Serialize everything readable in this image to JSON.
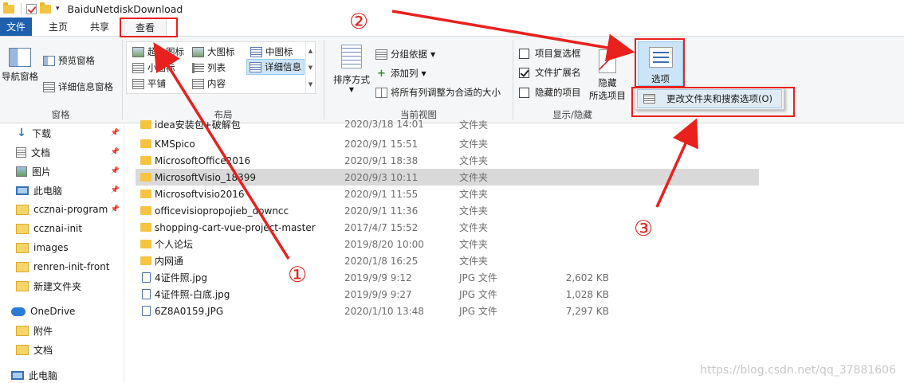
{
  "window": {
    "title": "BaiduNetdiskDownload"
  },
  "tabs": [
    "文件",
    "主页",
    "共享",
    "查看"
  ],
  "ribbon": {
    "pane_group": {
      "label": "窗格",
      "nav_pane": "导航窗格",
      "preview": "预览窗格",
      "details": "详细信息窗格"
    },
    "layout_group": {
      "label": "布局",
      "items": [
        "超大图标",
        "大图标",
        "中图标",
        "小图标",
        "列表",
        "详细信息",
        "平铺",
        "内容"
      ]
    },
    "current_view_group": {
      "label": "当前视图",
      "sort": "排序方式",
      "group_by": "分组依据",
      "add_column": "添加列",
      "fit_columns": "将所有列调整为合适的大小"
    },
    "show_hide_group": {
      "label": "显示/隐藏",
      "item_checkbox": "项目复选框",
      "extensions": "文件扩展名",
      "hidden_items": "隐藏的项目",
      "hide_selected_1": "隐藏",
      "hide_selected_2": "所选项目"
    },
    "options": {
      "label": "选项",
      "dropdown_item": "更改文件夹和搜索选项(O)"
    }
  },
  "checkboxes": {
    "item_checkbox": false,
    "extensions": true,
    "hidden_items": false
  },
  "nav": [
    {
      "label": "下载",
      "icon": "download-icon",
      "pinned": true
    },
    {
      "label": "文档",
      "icon": "document-icon",
      "pinned": true
    },
    {
      "label": "图片",
      "icon": "picture-icon",
      "pinned": true
    },
    {
      "label": "此电脑",
      "icon": "computer-icon",
      "pinned": true
    },
    {
      "label": "ccznai-program",
      "icon": "folder-icon",
      "pinned": true
    },
    {
      "label": "ccznai-init",
      "icon": "folder-icon",
      "pinned": false
    },
    {
      "label": "images",
      "icon": "folder-icon",
      "pinned": false
    },
    {
      "label": "renren-init-front",
      "icon": "folder-icon",
      "pinned": false
    },
    {
      "label": "新建文件夹",
      "icon": "folder-icon",
      "pinned": false
    },
    {
      "label": "OneDrive",
      "icon": "onedrive-icon",
      "pinned": false
    },
    {
      "label": "附件",
      "icon": "folder-icon",
      "pinned": false
    },
    {
      "label": "文档",
      "icon": "folder-icon",
      "pinned": false
    },
    {
      "label": "此电脑",
      "icon": "computer-icon",
      "pinned": false
    }
  ],
  "files": [
    {
      "name": "idea安装包+破解包",
      "date": "2020/3/18 14:01",
      "type": "文件夹",
      "size": "",
      "kind": "folder"
    },
    {
      "name": "KMSpico",
      "date": "2020/9/1 15:51",
      "type": "文件夹",
      "size": "",
      "kind": "folder"
    },
    {
      "name": "MicrosoftOffice2016",
      "date": "2020/9/1 18:38",
      "type": "文件夹",
      "size": "",
      "kind": "folder"
    },
    {
      "name": "MicrosoftVisio_18399",
      "date": "2020/9/3 10:11",
      "type": "文件夹",
      "size": "",
      "kind": "folder",
      "selected": true
    },
    {
      "name": "Microsoftvisio2016",
      "date": "2020/9/1 11:55",
      "type": "文件夹",
      "size": "",
      "kind": "folder"
    },
    {
      "name": "officevisiopropojieb_downcc",
      "date": "2020/9/1 11:36",
      "type": "文件夹",
      "size": "",
      "kind": "folder"
    },
    {
      "name": "shopping-cart-vue-project-master",
      "date": "2017/4/7 15:52",
      "type": "文件夹",
      "size": "",
      "kind": "folder"
    },
    {
      "name": "个人论坛",
      "date": "2019/8/20 10:00",
      "type": "文件夹",
      "size": "",
      "kind": "folder"
    },
    {
      "name": "内网通",
      "date": "2020/1/8 16:25",
      "type": "文件夹",
      "size": "",
      "kind": "folder"
    },
    {
      "name": "4证件照.jpg",
      "date": "2019/9/9 9:12",
      "type": "JPG 文件",
      "size": "2,602 KB",
      "kind": "file"
    },
    {
      "name": "4证件照-白底.jpg",
      "date": "2019/9/9 9:27",
      "type": "JPG 文件",
      "size": "1,028 KB",
      "kind": "file"
    },
    {
      "name": "6Z8A0159.JPG",
      "date": "2020/1/10 13:48",
      "type": "JPG 文件",
      "size": "7,297 KB",
      "kind": "file"
    }
  ],
  "annotations": {
    "step1": "①",
    "step2": "②",
    "step3": "③",
    "color": "#e8211e"
  },
  "watermark": "https://blog.csdn.net/qq_37881606"
}
